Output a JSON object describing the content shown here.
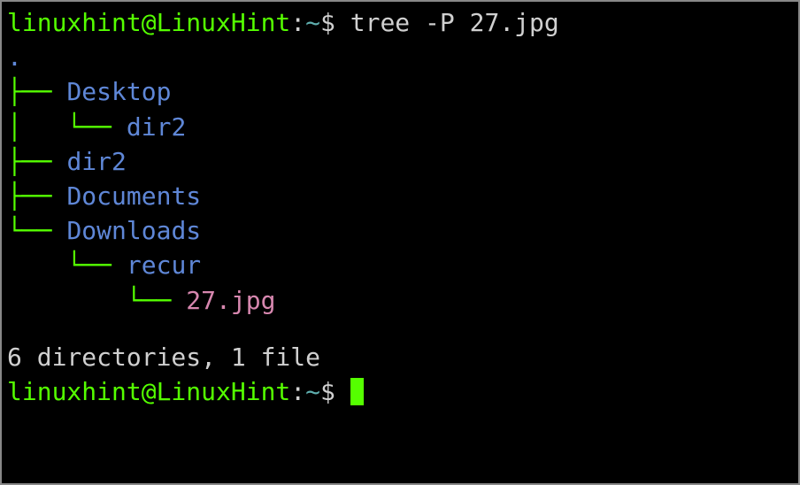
{
  "prompt1": {
    "user_host": "linuxhint@LinuxHint",
    "sep1": ":",
    "path": "~",
    "sep2": "$ ",
    "command": "tree -P 27.jpg"
  },
  "tree": {
    "root": ".",
    "l1": {
      "branch": "├── ",
      "name": "Desktop"
    },
    "l2": {
      "pipe": "│   ",
      "branch": "└── ",
      "name": "dir2"
    },
    "l3": {
      "branch": "├── ",
      "name": "dir2"
    },
    "l4": {
      "branch": "├── ",
      "name": "Documents"
    },
    "l5": {
      "branch": "└── ",
      "name": "Downloads"
    },
    "l6": {
      "pad": "    ",
      "branch": "└── ",
      "name": "recur"
    },
    "l7": {
      "pad": "        ",
      "branch": "└── ",
      "name": "27.jpg"
    }
  },
  "summary": "6 directories, 1 file",
  "prompt2": {
    "user_host": "linuxhint@LinuxHint",
    "sep1": ":",
    "path": "~",
    "sep2": "$ "
  }
}
